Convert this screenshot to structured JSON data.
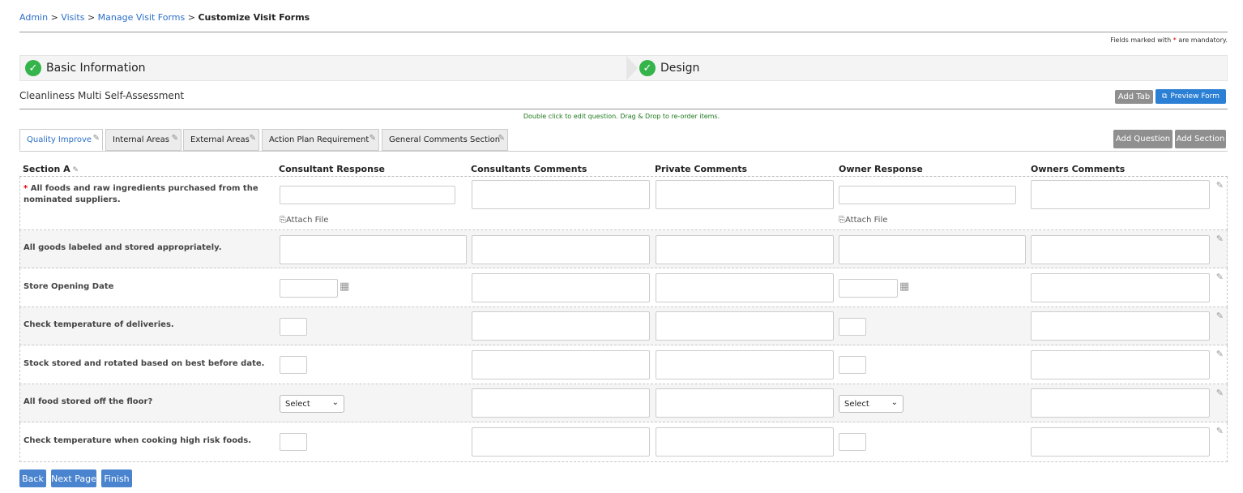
{
  "breadcrumb": {
    "items": [
      "Admin",
      "Visits",
      "Manage Visit Forms"
    ],
    "current": "Customize Visit Forms",
    "separator": ">"
  },
  "mandatory_note": {
    "prefix": "Fields marked with",
    "star": "*",
    "suffix": "are mandatory."
  },
  "wizard": {
    "steps": [
      "Basic Information",
      "Design"
    ]
  },
  "form_name": "Cleanliness Multi Self-Assessment",
  "buttons": {
    "add_tab": "Add Tab",
    "preview_form": "Preview Form",
    "add_question": "Add Question",
    "add_section": "Add Section"
  },
  "hint": "Double click to edit question. Drag & Drop to re-order items.",
  "tabs": [
    "Quality Improve",
    "Internal Areas",
    "External Areas",
    "Action Plan Requirement",
    "General Comments Section"
  ],
  "table": {
    "section_title": "Section A",
    "columns": [
      "Consultant Response",
      "Consultants Comments",
      "Private Comments",
      "Owner Response",
      "Owners Comments"
    ],
    "attach_label": "Attach File",
    "select_label": "Select",
    "questions": [
      "All foods and raw ingredients purchased from the nominated suppliers.",
      "All goods labeled and stored appropriately.",
      "Store Opening Date",
      "Check temperature of deliveries.",
      "Stock stored and rotated based on best before date.",
      "All food stored off the floor?",
      "Check temperature when cooking high risk foods."
    ]
  },
  "footer": {
    "back": "Back",
    "next_page": "Next Page",
    "finish": "Finish"
  },
  "colors": {
    "accent": "#2b7fd4",
    "check": "#34b44a",
    "hint": "#1d7a1d",
    "required": "#dd0000"
  },
  "icons": {
    "step_check": "check-circle-icon",
    "edit": "edit-icon",
    "calendar": "calendar-icon",
    "attach": "paperclip-icon",
    "chevron": "chevron-down-icon"
  }
}
